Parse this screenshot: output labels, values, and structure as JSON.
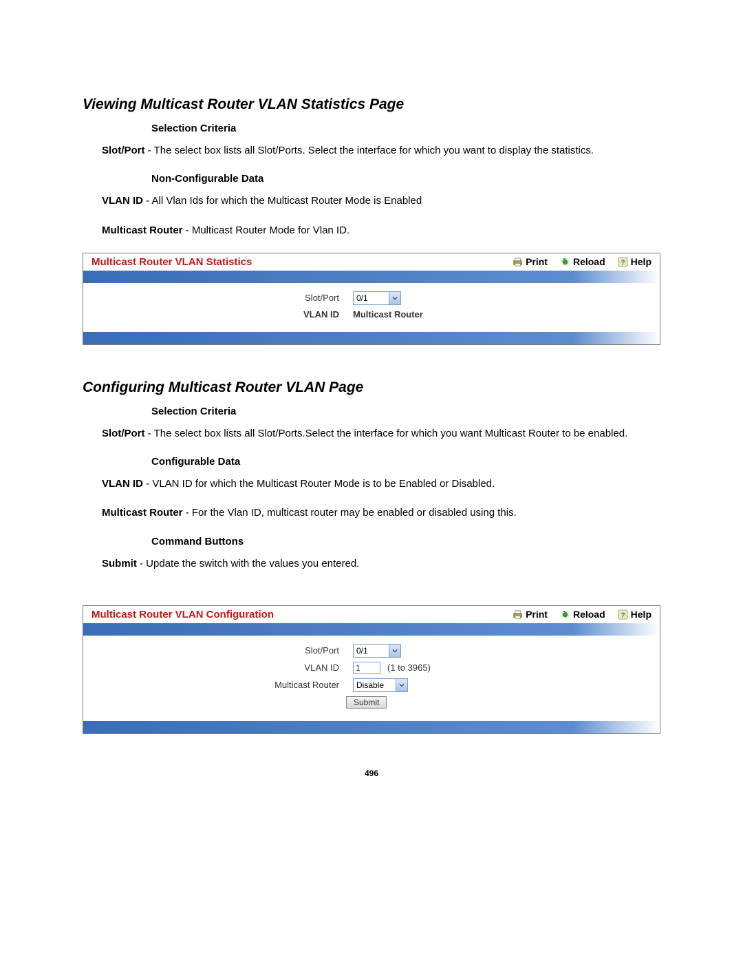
{
  "section1": {
    "title": "Viewing Multicast Router VLAN Statistics Page",
    "sub1": "Selection Criteria",
    "p1_lead": "Slot/Port",
    "p1_rest": " - The select box lists all Slot/Ports. Select the interface for which you want to display the statistics.",
    "sub2": "Non-Configurable Data",
    "p2_lead": "VLAN ID",
    "p2_rest": " - All Vlan Ids for which the Multicast Router Mode is Enabled",
    "p3_lead": "Multicast Router",
    "p3_rest": " - Multicast Router Mode for Vlan ID."
  },
  "panelA": {
    "title": "Multicast Router VLAN Statistics",
    "print": "Print",
    "reload": "Reload",
    "help": "Help",
    "slotport_label": "Slot/Port",
    "slotport_value": "0/1",
    "col_vlan": "VLAN ID",
    "col_mr": "Multicast Router"
  },
  "section2": {
    "title": "Configuring Multicast Router VLAN Page",
    "sub1": "Selection Criteria",
    "p1_lead": "Slot/Port",
    "p1_rest": " - The select box lists all Slot/Ports.Select the interface for which you want Multicast Router to be enabled.",
    "sub2": "Configurable Data",
    "p2_lead": "VLAN ID",
    "p2_rest": " - VLAN ID for which the Multicast Router Mode is to be Enabled or Disabled.",
    "p3_lead": "Multicast Router",
    "p3_rest": " - For the Vlan ID, multicast router may be enabled or disabled using this.",
    "sub3": "Command Buttons",
    "p4_lead": "Submit",
    "p4_rest": " - Update the switch with the values you entered."
  },
  "panelB": {
    "title": "Multicast Router VLAN Configuration",
    "print": "Print",
    "reload": "Reload",
    "help": "Help",
    "slotport_label": "Slot/Port",
    "slotport_value": "0/1",
    "vlanid_label": "VLAN ID",
    "vlanid_value": "1",
    "vlanid_hint": "(1 to 3965)",
    "mr_label": "Multicast Router",
    "mr_value": "Disable",
    "submit": "Submit"
  },
  "pageNumber": "496"
}
